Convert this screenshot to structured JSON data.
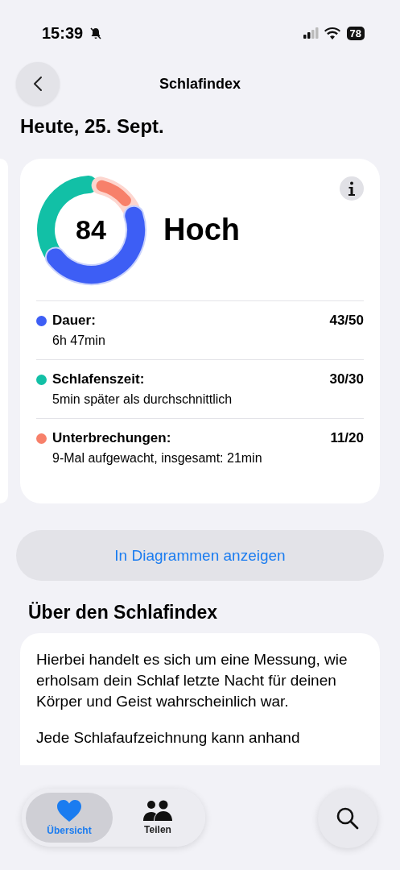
{
  "status_bar": {
    "time": "15:39",
    "silent": true,
    "battery": "78"
  },
  "nav": {
    "title": "Schlafindex"
  },
  "date_heading": "Heute, 25. Sept.",
  "score_card": {
    "score": "84",
    "rating": "Hoch",
    "metrics": [
      {
        "label": "Dauer:",
        "value": "6h 47min",
        "points": "43/50",
        "color": "#3d5ef5"
      },
      {
        "label": "Schlafenszeit:",
        "value": "5min später als durchschnittlich",
        "points": "30/30",
        "color": "#12c0a6"
      },
      {
        "label": "Unterbrechungen:",
        "value": "9-Mal aufgewacht, insgesamt: 21min",
        "points": "11/20",
        "color": "#f7806a"
      }
    ]
  },
  "chart_button": "In Diagrammen anzeigen",
  "about": {
    "title": "Über den Schlafindex",
    "paragraphs": [
      "Hierbei handelt es sich um eine Messung, wie erholsam dein Schlaf letzte Nacht für deinen Körper und Geist wahrscheinlich war.",
      "Jede Schlafaufzeichnung kann anhand"
    ]
  },
  "tabs": [
    {
      "label": "Übersicht",
      "selected": true,
      "kind": "heart"
    },
    {
      "label": "Teilen",
      "selected": false,
      "kind": "people"
    }
  ]
}
